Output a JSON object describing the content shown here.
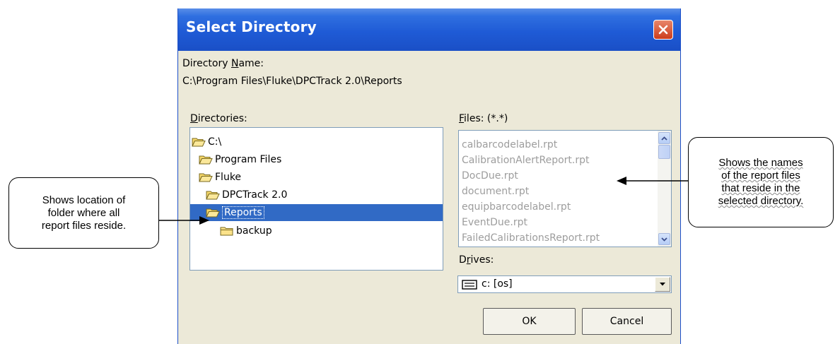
{
  "dialog": {
    "title": "Select Directory",
    "directory_name_label_prefix": "Directory ",
    "directory_name_label_mnemonic": "N",
    "directory_name_label_rest": "ame:",
    "directory_path": "C:\\Program Files\\Fluke\\DPCTrack 2.0\\Reports",
    "directories_label_mnemonic": "D",
    "directories_label_rest": "irectories:",
    "files_label_mnemonic": "F",
    "files_label_rest": "iles: (*.*)",
    "drives_label_prefix": "D",
    "drives_label_mnemonic": "r",
    "drives_label_rest": "ives:",
    "directories": [
      {
        "label": "C:\\",
        "open": true,
        "selected": false
      },
      {
        "label": "Program Files",
        "open": true,
        "selected": false
      },
      {
        "label": "Fluke",
        "open": true,
        "selected": false
      },
      {
        "label": "DPCTrack 2.0",
        "open": true,
        "selected": false
      },
      {
        "label": "Reports",
        "open": true,
        "selected": true
      },
      {
        "label": "backup",
        "open": false,
        "selected": false
      }
    ],
    "files": [
      "calbarcodelabel.rpt",
      "CalibrationAlertReport.rpt",
      "DocDue.rpt",
      "document.rpt",
      "equipbarcodelabel.rpt",
      "EventDue.rpt",
      "FailedCalibrationsReport.rpt"
    ],
    "drive_value": "c: [os]",
    "ok_label": "OK",
    "cancel_label": "Cancel"
  },
  "callouts": {
    "left": [
      "Shows location of",
      "folder where all",
      "report files reside."
    ],
    "right": [
      "Shows the names",
      "of the report files",
      "that reside in the",
      "selected directory."
    ]
  },
  "colors": {
    "title_bar": "#1f5bd6",
    "dialog_bg": "#ece9d8",
    "selection": "#316ac5",
    "disabled_text": "#9d9d9d"
  }
}
